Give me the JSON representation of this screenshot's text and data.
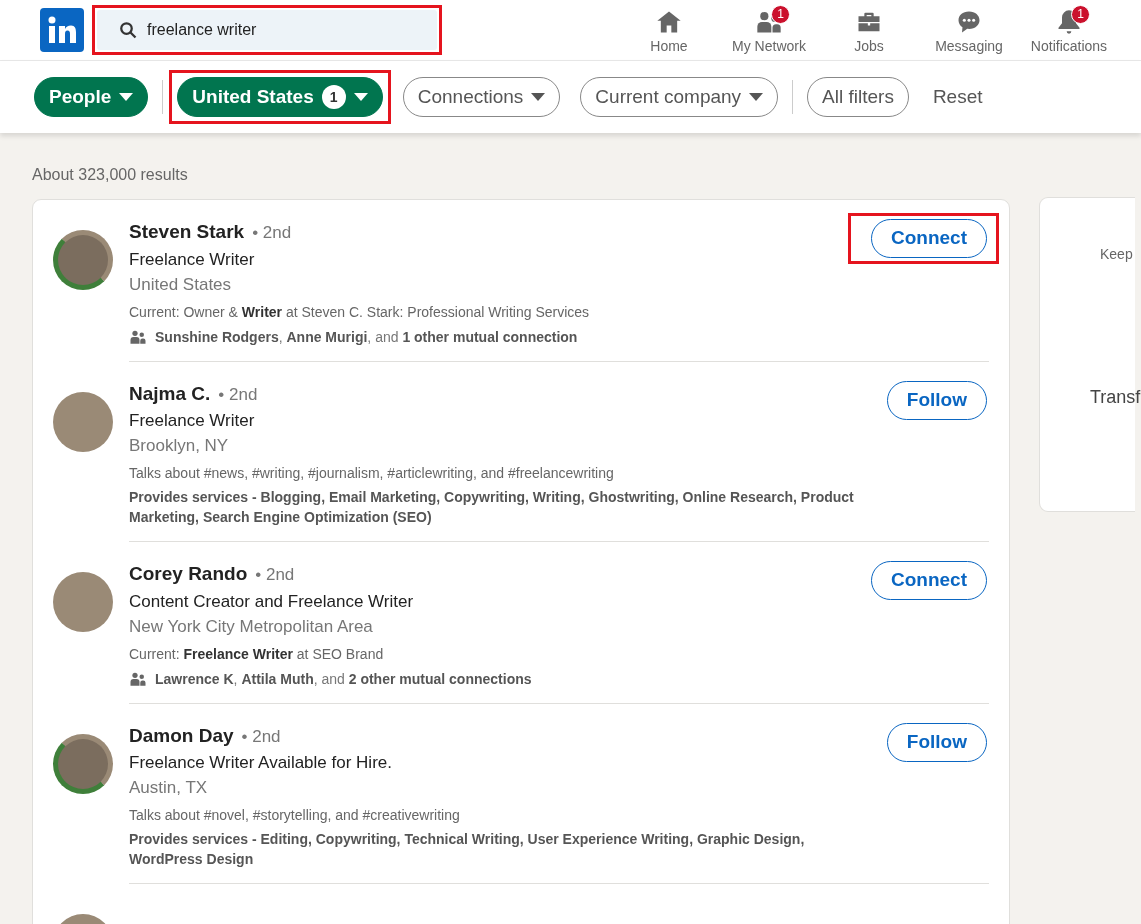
{
  "search": {
    "value": "freelance writer",
    "highlighted": true
  },
  "nav": [
    {
      "label": "Home",
      "kind": "home"
    },
    {
      "label": "My Network",
      "kind": "network",
      "badge": "1"
    },
    {
      "label": "Jobs",
      "kind": "jobs"
    },
    {
      "label": "Messaging",
      "kind": "messaging"
    },
    {
      "label": "Notifications",
      "kind": "notifications",
      "badge": "1"
    }
  ],
  "filter_groups": [
    [
      {
        "label": "People",
        "selected": true,
        "kind": "dropdown",
        "highlighted": false
      }
    ],
    [
      {
        "label": "United States",
        "selected": true,
        "count": "1",
        "kind": "dropdown",
        "highlighted": true
      },
      {
        "label": "Connections",
        "selected": false,
        "kind": "dropdown",
        "highlighted": false
      },
      {
        "label": "Current company",
        "selected": false,
        "kind": "dropdown",
        "highlighted": false
      }
    ],
    [
      {
        "label": "All filters",
        "selected": false,
        "kind": "button",
        "highlighted": false
      }
    ]
  ],
  "reset": "Reset",
  "results_count": "About 323,000 results",
  "results": [
    {
      "name": "Steven Stark",
      "degree": "• 2nd",
      "headline": "Freelance Writer",
      "location": "United States",
      "open_to_work": true,
      "details": [
        {
          "kind": "current",
          "text": "Current: Owner & **Writer** at Steven C. Stark: Professional Writing Services"
        },
        {
          "kind": "mutual",
          "text": "**Sunshine Rodgers**, **Anne Murigi**, and **1 other mutual connection**"
        }
      ],
      "action": "Connect",
      "highlighted": true
    },
    {
      "name": "Najma C.",
      "degree": "• 2nd",
      "headline": "Freelance Writer",
      "location": "Brooklyn, NY",
      "open_to_work": false,
      "details": [
        {
          "kind": "talks",
          "text": "Talks about #news, #writing, #journalism, #articlewriting, and #freelancewriting"
        },
        {
          "kind": "services",
          "text": "Provides services - Blogging, Email Marketing, Copywriting, Writing, Ghostwriting, Online Research, Product Marketing, Search Engine Optimization (SEO)"
        }
      ],
      "action": "Follow",
      "highlighted": false
    },
    {
      "name": "Corey Rando",
      "degree": "• 2nd",
      "headline": "Content Creator and Freelance Writer",
      "location": "New York City Metropolitan Area",
      "open_to_work": false,
      "details": [
        {
          "kind": "current",
          "text": "Current: **Freelance Writer** at SEO Brand"
        },
        {
          "kind": "mutual",
          "text": "**Lawrence K**, **Attila Muth**, and **2 other mutual connections**"
        }
      ],
      "action": "Connect",
      "highlighted": false
    },
    {
      "name": "Damon Day",
      "degree": "• 2nd",
      "headline": "Freelance Writer Available for Hire.",
      "location": "Austin, TX",
      "open_to_work": true,
      "details": [
        {
          "kind": "talks",
          "text": "Talks about #novel, #storytelling, and #creativewriting"
        },
        {
          "kind": "services",
          "text": "Provides services - Editing, Copywriting, Technical Writing, User Experience Writing, Graphic Design, WordPress Design"
        }
      ],
      "action": "Follow",
      "highlighted": false
    }
  ],
  "side_card": {
    "line_1": "Keep",
    "line_2": "Transf"
  }
}
